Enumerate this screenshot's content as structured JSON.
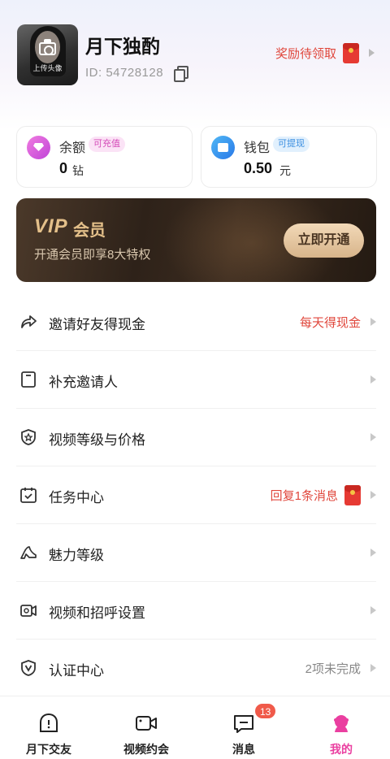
{
  "profile": {
    "nickname": "月下独酌",
    "id_text": "ID: 54728128",
    "avatar_label": "上传头像",
    "reward_text": "奖励待领取"
  },
  "wallet": {
    "balance": {
      "label": "余额",
      "badge": "可充值",
      "amount": "0",
      "unit": "钻"
    },
    "purse": {
      "label": "钱包",
      "badge": "可提现",
      "amount": "0.50",
      "unit": "元"
    }
  },
  "vip": {
    "mark": "VIP",
    "title": "会员",
    "description": "开通会员即享8大特权",
    "button": "立即开通"
  },
  "menu": [
    {
      "label": "邀请好友得现金",
      "right": "每天得现金",
      "icon": "share-icon"
    },
    {
      "label": "补充邀请人",
      "right": "",
      "icon": "bookmark-icon"
    },
    {
      "label": "视频等级与价格",
      "right": "",
      "icon": "star-shield-icon"
    },
    {
      "label": "任务中心",
      "right": "回复1条消息",
      "icon": "calendar-check-icon"
    },
    {
      "label": "魅力等级",
      "right": "",
      "icon": "high-heel-icon"
    },
    {
      "label": "视频和招呼设置",
      "right": "",
      "icon": "video-settings-icon"
    },
    {
      "label": "认证中心",
      "right": "2项未完成",
      "icon": "verified-shield-icon"
    }
  ],
  "tabbar": {
    "tabs": [
      {
        "label": "月下交友",
        "icon": "home-icon"
      },
      {
        "label": "视频约会",
        "icon": "video-camera-icon"
      },
      {
        "label": "消息",
        "icon": "message-icon"
      },
      {
        "label": "我的",
        "icon": "profile-icon"
      }
    ],
    "message_badge": "13",
    "active_index": 3
  },
  "colors": {
    "accent_red": "#e0473c",
    "active_tab": "#ea3fa0",
    "vip_gold": "#e4c08a"
  }
}
